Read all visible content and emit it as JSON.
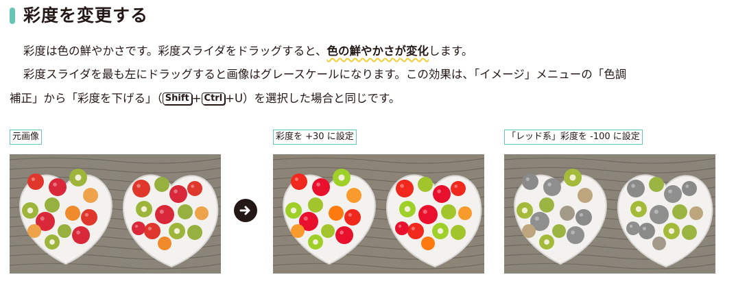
{
  "header": {
    "title": "彩度を変更する"
  },
  "body": {
    "p1_a": "彩度は色の鮮やかさです。彩度スライダをドラッグすると、",
    "p1_highlight": "色の鮮やかさが変化",
    "p1_b": "します。",
    "p2": "彩度スライダを最も左にドラッグすると画像はグレースケールになります。この効果は、「イメージ」メニューの「色調",
    "p3_a": "補正」から「彩度を下げる」（",
    "key_shift": "Shift",
    "plus1": "+",
    "key_ctrl": "Ctrl",
    "p3_b": "+U）を選択した場合と同じです。"
  },
  "captions": {
    "original": "元画像",
    "saturation_plus": "彩度を +30 に設定",
    "red_minus": "「レッド系」彩度を -100 に設定"
  },
  "images": [
    {
      "name": "original",
      "mode": "original"
    },
    {
      "name": "saturation-plus-30",
      "mode": "saturated"
    },
    {
      "name": "red-minus-100",
      "mode": "redless"
    }
  ],
  "icons": {
    "arrow": "arrow-right-circle-icon"
  },
  "colors": {
    "accent": "#67c5b6",
    "highlight_underline": "#f2cd3a",
    "text": "#231815"
  }
}
